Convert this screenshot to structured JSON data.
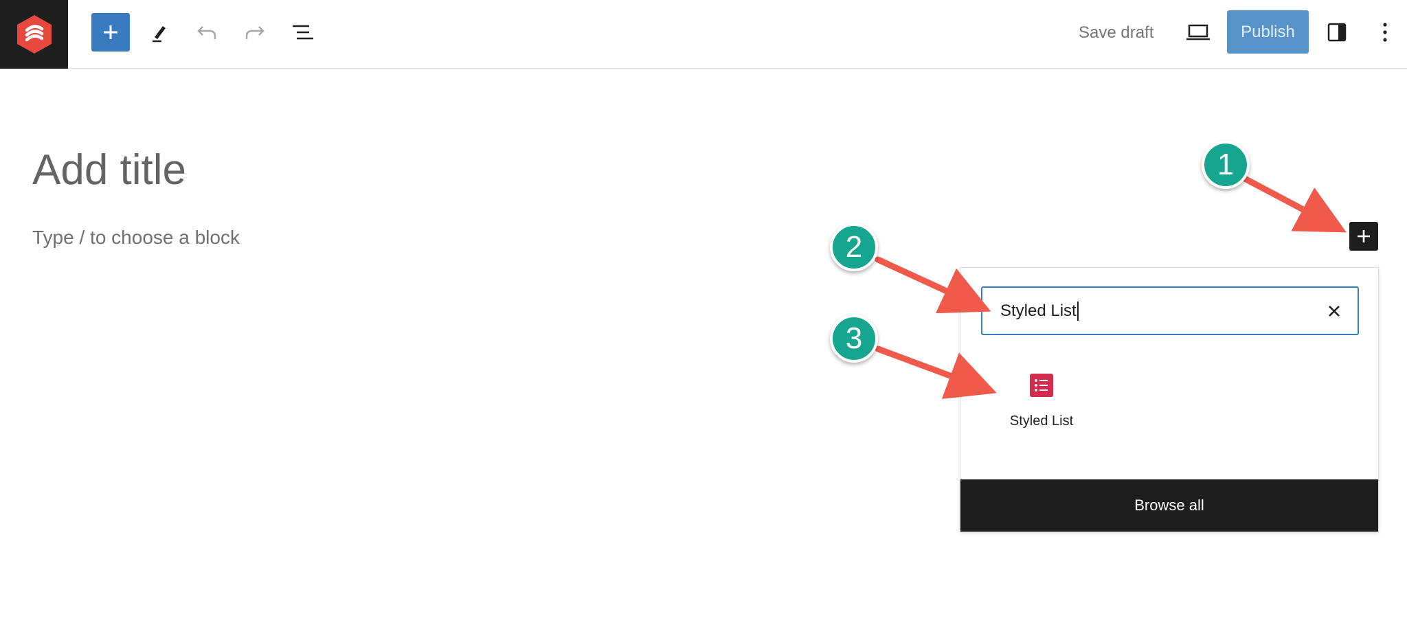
{
  "toolbar": {
    "save_draft": "Save draft",
    "publish": "Publish",
    "icons": [
      "brand-logo-icon",
      "plus-icon",
      "pencil-icon",
      "undo-icon",
      "redo-icon",
      "list-view-icon",
      "desktop-preview-icon",
      "settings-sidebar-icon",
      "more-vertical-icon"
    ]
  },
  "editor": {
    "title_placeholder": "Add title",
    "block_placeholder": "Type / to choose a block"
  },
  "inserter": {
    "search_value": "Styled List",
    "results": [
      {
        "label": "Styled List",
        "icon": "styled-list-icon"
      }
    ],
    "browse_all": "Browse all"
  },
  "annotations": {
    "steps": [
      "1",
      "2",
      "3"
    ],
    "badge_color": "#16a68f",
    "arrow_color": "#f05a4b"
  },
  "colors": {
    "primary": "#3a7bbf",
    "publish_bg": "#5793c8",
    "dark": "#1e1e1e",
    "styled_list_icon": "#d22d4e"
  }
}
